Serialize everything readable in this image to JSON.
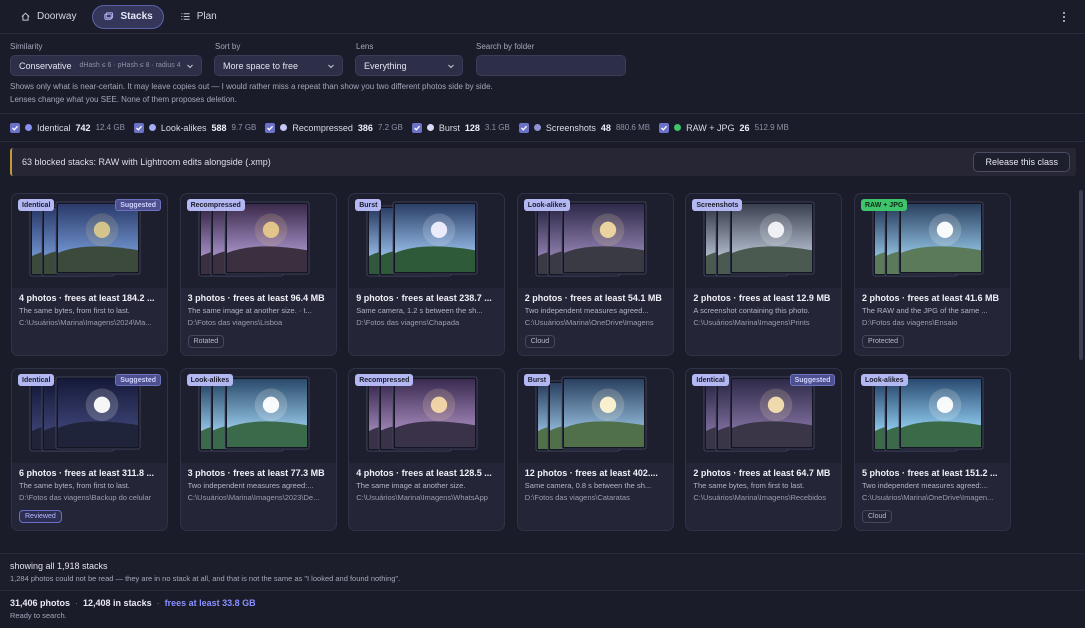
{
  "nav": {
    "tabs": [
      {
        "label": "Doorway",
        "icon": "home-icon",
        "active": false
      },
      {
        "label": "Stacks",
        "icon": "stacks-icon",
        "active": true
      },
      {
        "label": "Plan",
        "icon": "list-icon",
        "active": false
      }
    ]
  },
  "filters": {
    "similarity_label": "Similarity",
    "similarity_value": "Conservative",
    "similarity_detail": "dHash ≤ 6 · pHash ≤ 8 · radius 4",
    "sort_label": "Sort by",
    "sort_value": "More space to free",
    "lens_label": "Lens",
    "lens_value": "Everything",
    "search_label": "Search by folder",
    "search_value": "",
    "note1": "Shows only what is near-certain. It may leave copies out — I would rather miss a repeat than show you two different photos side by side.",
    "note2": "Lenses change what you SEE. None of them proposes deletion."
  },
  "lenses": [
    {
      "name": "Identical",
      "count": "742",
      "size": "12.4 GB",
      "color": "#8a90f0"
    },
    {
      "name": "Look-alikes",
      "count": "588",
      "size": "9.7 GB",
      "color": "#a7abf4"
    },
    {
      "name": "Recompressed",
      "count": "386",
      "size": "7.2 GB",
      "color": "#c4c6f6"
    },
    {
      "name": "Burst",
      "count": "128",
      "size": "3.1 GB",
      "color": "#d9daf8"
    },
    {
      "name": "Screenshots",
      "count": "48",
      "size": "880.6 MB",
      "color": "#8e93d6"
    },
    {
      "name": "RAW + JPG",
      "count": "26",
      "size": "512.9 MB",
      "color": "#3ec46b"
    }
  ],
  "banner": {
    "text": "63 blocked stacks: RAW with Lightroom edits alongside (.xmp)",
    "button": "Release this class"
  },
  "cards": [
    {
      "badge": "Identical",
      "suggested": "Suggested",
      "title": "4 photos · frees at least 184.2 ...",
      "desc": "The same bytes, from first to last.",
      "path": "C:\\Usuários\\Marina\\Imagens\\2024\\Ma...",
      "chip": ""
    },
    {
      "badge": "Recompressed",
      "suggested": "",
      "title": "3 photos · frees at least 96.4 MB",
      "desc": "The same image at another size. · t...",
      "path": "D:\\Fotos das viagens\\Lisboa",
      "chip": "Rotated"
    },
    {
      "badge": "Burst",
      "suggested": "",
      "title": "9 photos · frees at least 238.7 ...",
      "desc": "Same camera, 1.2 s between the sh...",
      "path": "D:\\Fotos das viagens\\Chapada",
      "chip": ""
    },
    {
      "badge": "Look-alikes",
      "suggested": "",
      "title": "2 photos · frees at least 54.1 MB",
      "desc": "Two independent measures agreed...",
      "path": "C:\\Usuários\\Marina\\OneDrive\\Imagens",
      "chip": "Cloud"
    },
    {
      "badge": "Screenshots",
      "suggested": "",
      "title": "2 photos · frees at least 12.9 MB",
      "desc": "A screenshot containing this photo.",
      "path": "C:\\Usuários\\Marina\\Imagens\\Prints",
      "chip": ""
    },
    {
      "badge": "RAW + JPG",
      "suggested": "",
      "title": "2 photos · frees at least 41.6 MB",
      "desc": "The RAW and the JPG of the same ...",
      "path": "D:\\Fotos das viagens\\Ensaio",
      "chip": "Protected"
    },
    {
      "badge": "Identical",
      "suggested": "Suggested",
      "title": "6 photos · frees at least 311.8 ...",
      "desc": "The same bytes, from first to last.",
      "path": "D:\\Fotos das viagens\\Backup do celular",
      "chip": "Reviewed"
    },
    {
      "badge": "Look-alikes",
      "suggested": "",
      "title": "3 photos · frees at least 77.3 MB",
      "desc": "Two independent measures agreed:...",
      "path": "C:\\Usuários\\Marina\\Imagens\\2023\\De...",
      "chip": ""
    },
    {
      "badge": "Recompressed",
      "suggested": "",
      "title": "4 photos · frees at least 128.5 ...",
      "desc": "The same image at another size.",
      "path": "C:\\Usuários\\Marina\\Imagens\\WhatsApp",
      "chip": ""
    },
    {
      "badge": "Burst",
      "suggested": "",
      "title": "12 photos · frees at least 402....",
      "desc": "Same camera, 0.8 s between the sh...",
      "path": "D:\\Fotos das viagens\\Cataratas",
      "chip": ""
    },
    {
      "badge": "Identical",
      "suggested": "Suggested",
      "title": "2 photos · frees at least 64.7 MB",
      "desc": "The same bytes, from first to last.",
      "path": "C:\\Usuários\\Marina\\Imagens\\Recebidos",
      "chip": ""
    },
    {
      "badge": "Look-alikes",
      "suggested": "",
      "title": "5 photos · frees at least 151.2 ...",
      "desc": "Two independent measures agreed:...",
      "path": "C:\\Usuários\\Marina\\OneDrive\\Imagen...",
      "chip": "Cloud"
    }
  ],
  "status": {
    "showing": "showing all 1,918 stacks",
    "unread_note": "1,284 photos could not be read — they are in no stack at all, and that is not the same as \"I looked and found nothing\".",
    "photos": "31,406 photos",
    "in_stacks": "12,408 in stacks",
    "frees": "frees at least 33.8 GB",
    "ready": "Ready to search."
  }
}
